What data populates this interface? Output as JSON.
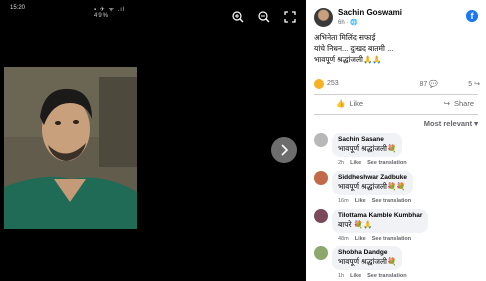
{
  "status_bar": {
    "time": "15:20",
    "icons": "▪ ✈ ᯤ .ıl 49%"
  },
  "viewer": {
    "zoom_in": "zoom-in-icon",
    "zoom_out": "zoom-out-icon",
    "fullscreen": "fullscreen-icon",
    "next": "chevron-right-icon"
  },
  "post": {
    "author": "Sachin Goswami",
    "time": "6h",
    "privacy_icon": "globe-icon",
    "text_lines": [
      "अभिनेता मिलिंद सफाई",
      "यांचे निधन... दुःखद बातमी ...",
      "भावपूर्ण श्रद्धांजली🙏🙏"
    ],
    "reaction_count": "253",
    "comment_count": "87",
    "share_count": "5"
  },
  "actions": {
    "like": "Like",
    "share": "Share"
  },
  "sort_label": "Most relevant",
  "comments": [
    {
      "name": "Sachin Sasane",
      "text": "भावपूर्ण श्रद्धांजली💐",
      "time": "2h",
      "like": "Like",
      "translate": "See translation",
      "color": "#b8b8b8"
    },
    {
      "name": "Siddheshwar Zadbuke",
      "text": "भावपूर्ण श्रद्धांजली💐💐",
      "time": "16m",
      "like": "Like",
      "translate": "See translation",
      "color": "#c06a4a"
    },
    {
      "name": "Tilottama Kamble Kumbhar",
      "text": "बापरे 💐🙏",
      "time": "48m",
      "like": "Like",
      "translate": "See translation",
      "color": "#7a4a5a"
    },
    {
      "name": "Shobha Dandge",
      "text": "भावपूर्ण श्रद्धांजली💐",
      "time": "1h",
      "like": "Like",
      "translate": "See translation",
      "color": "#8ca86a"
    }
  ]
}
